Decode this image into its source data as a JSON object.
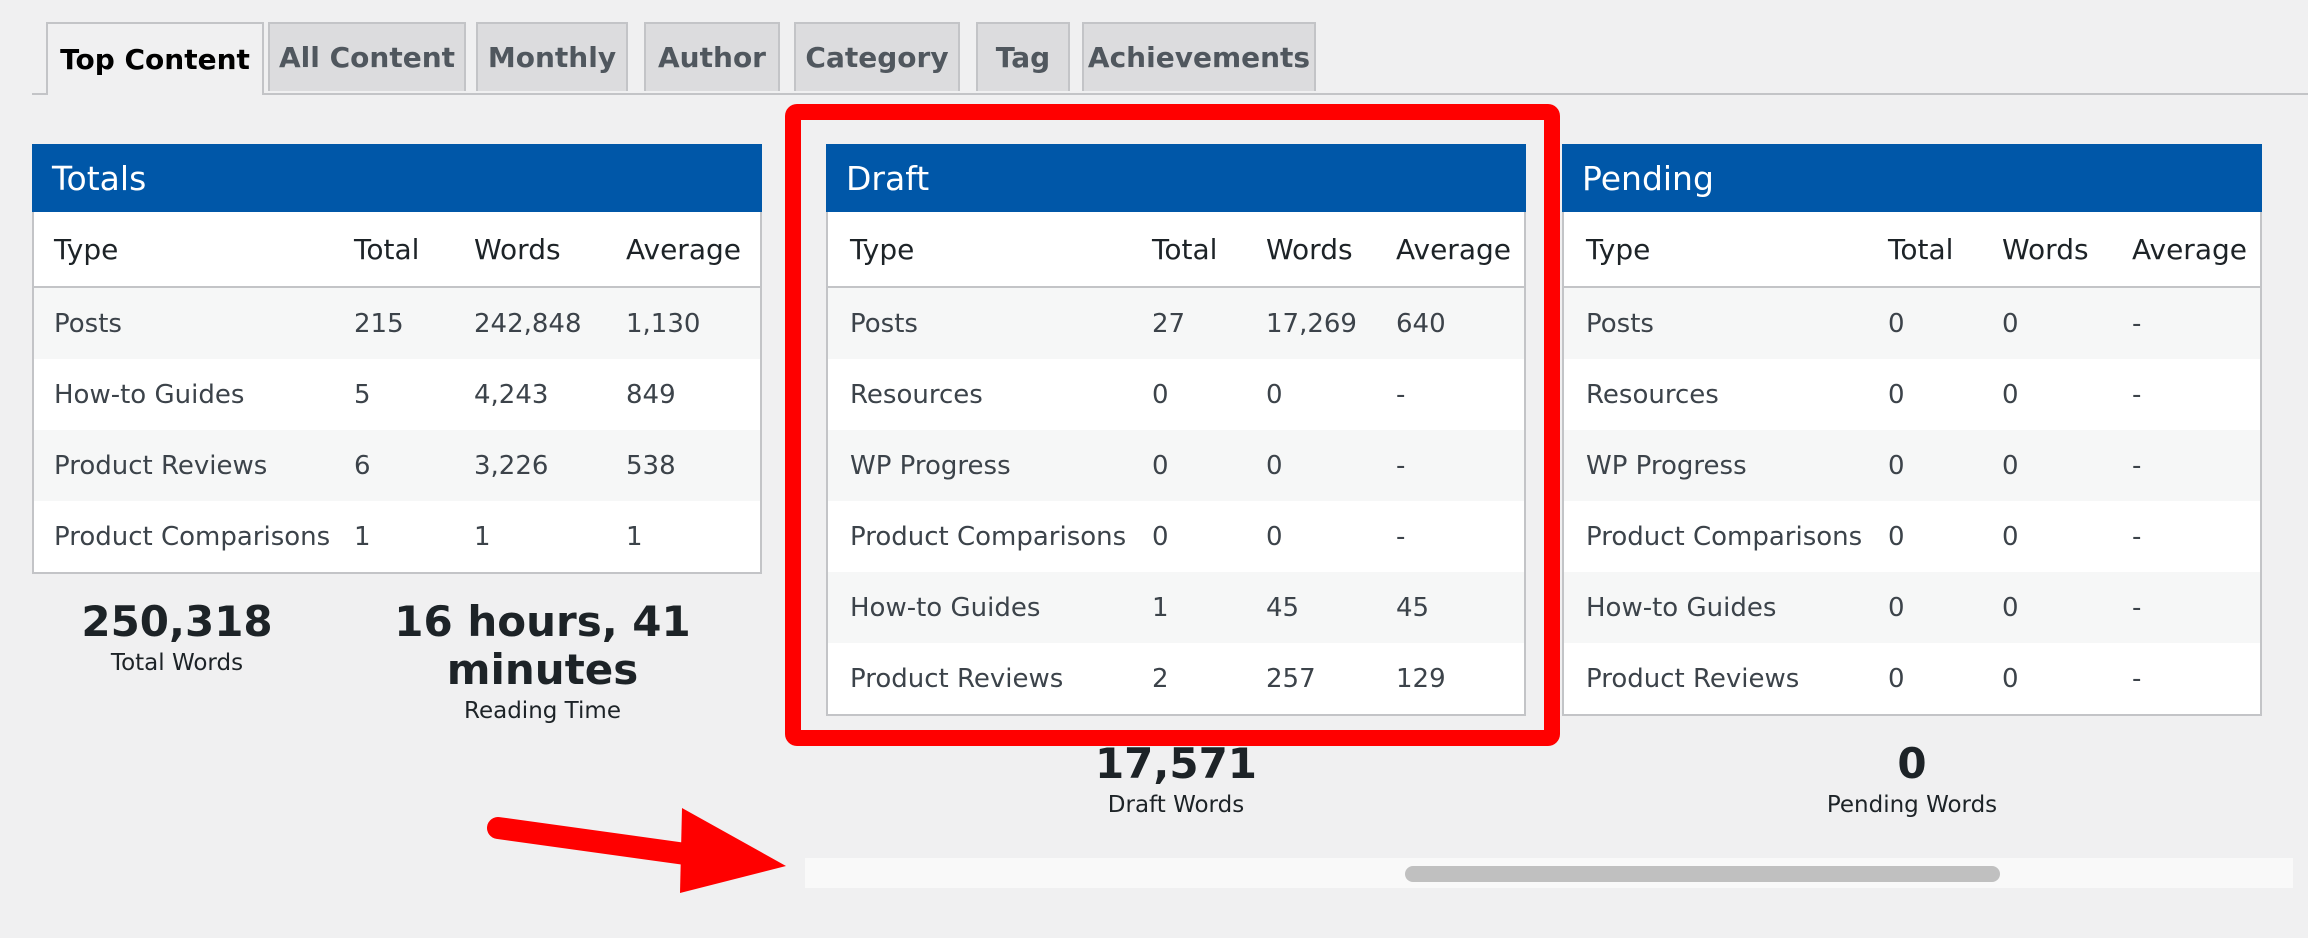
{
  "tabs": [
    {
      "label": "Top Content",
      "active": true
    },
    {
      "label": "All Content"
    },
    {
      "label": "Monthly"
    },
    {
      "label": "Author"
    },
    {
      "label": "Category"
    },
    {
      "label": "Tag"
    },
    {
      "label": "Achievements"
    }
  ],
  "totals": {
    "title": "Totals",
    "columns": [
      "Type",
      "Total",
      "Words",
      "Average"
    ],
    "rows": [
      [
        "Posts",
        "215",
        "242,848",
        "1,130"
      ],
      [
        "How-to Guides",
        "5",
        "4,243",
        "849"
      ],
      [
        "Product Reviews",
        "6",
        "3,226",
        "538"
      ],
      [
        "Product Comparisons",
        "1",
        "1",
        "1"
      ]
    ],
    "total_words": "250,318",
    "total_words_label": "Total Words",
    "reading_time": "16 hours, 41 minutes",
    "reading_time_label": "Reading Time"
  },
  "draft": {
    "title": "Draft",
    "columns": [
      "Type",
      "Total",
      "Words",
      "Average"
    ],
    "rows": [
      [
        "Posts",
        "27",
        "17,269",
        "640"
      ],
      [
        "Resources",
        "0",
        "0",
        "-"
      ],
      [
        "WP Progress",
        "0",
        "0",
        "-"
      ],
      [
        "Product Comparisons",
        "0",
        "0",
        "-"
      ],
      [
        "How-to Guides",
        "1",
        "45",
        "45"
      ],
      [
        "Product Reviews",
        "2",
        "257",
        "129"
      ]
    ],
    "words": "17,571",
    "words_label": "Draft Words"
  },
  "pending": {
    "title": "Pending",
    "columns": [
      "Type",
      "Total",
      "Words",
      "Average"
    ],
    "rows": [
      [
        "Posts",
        "0",
        "0",
        "-"
      ],
      [
        "Resources",
        "0",
        "0",
        "-"
      ],
      [
        "WP Progress",
        "0",
        "0",
        "-"
      ],
      [
        "Product Comparisons",
        "0",
        "0",
        "-"
      ],
      [
        "How-to Guides",
        "0",
        "0",
        "-"
      ],
      [
        "Product Reviews",
        "0",
        "0",
        "-"
      ]
    ],
    "words": "0",
    "words_label": "Pending Words"
  },
  "colors": {
    "header": "#0057a8",
    "highlight": "#ff0000",
    "arrow": "#ff0000"
  }
}
